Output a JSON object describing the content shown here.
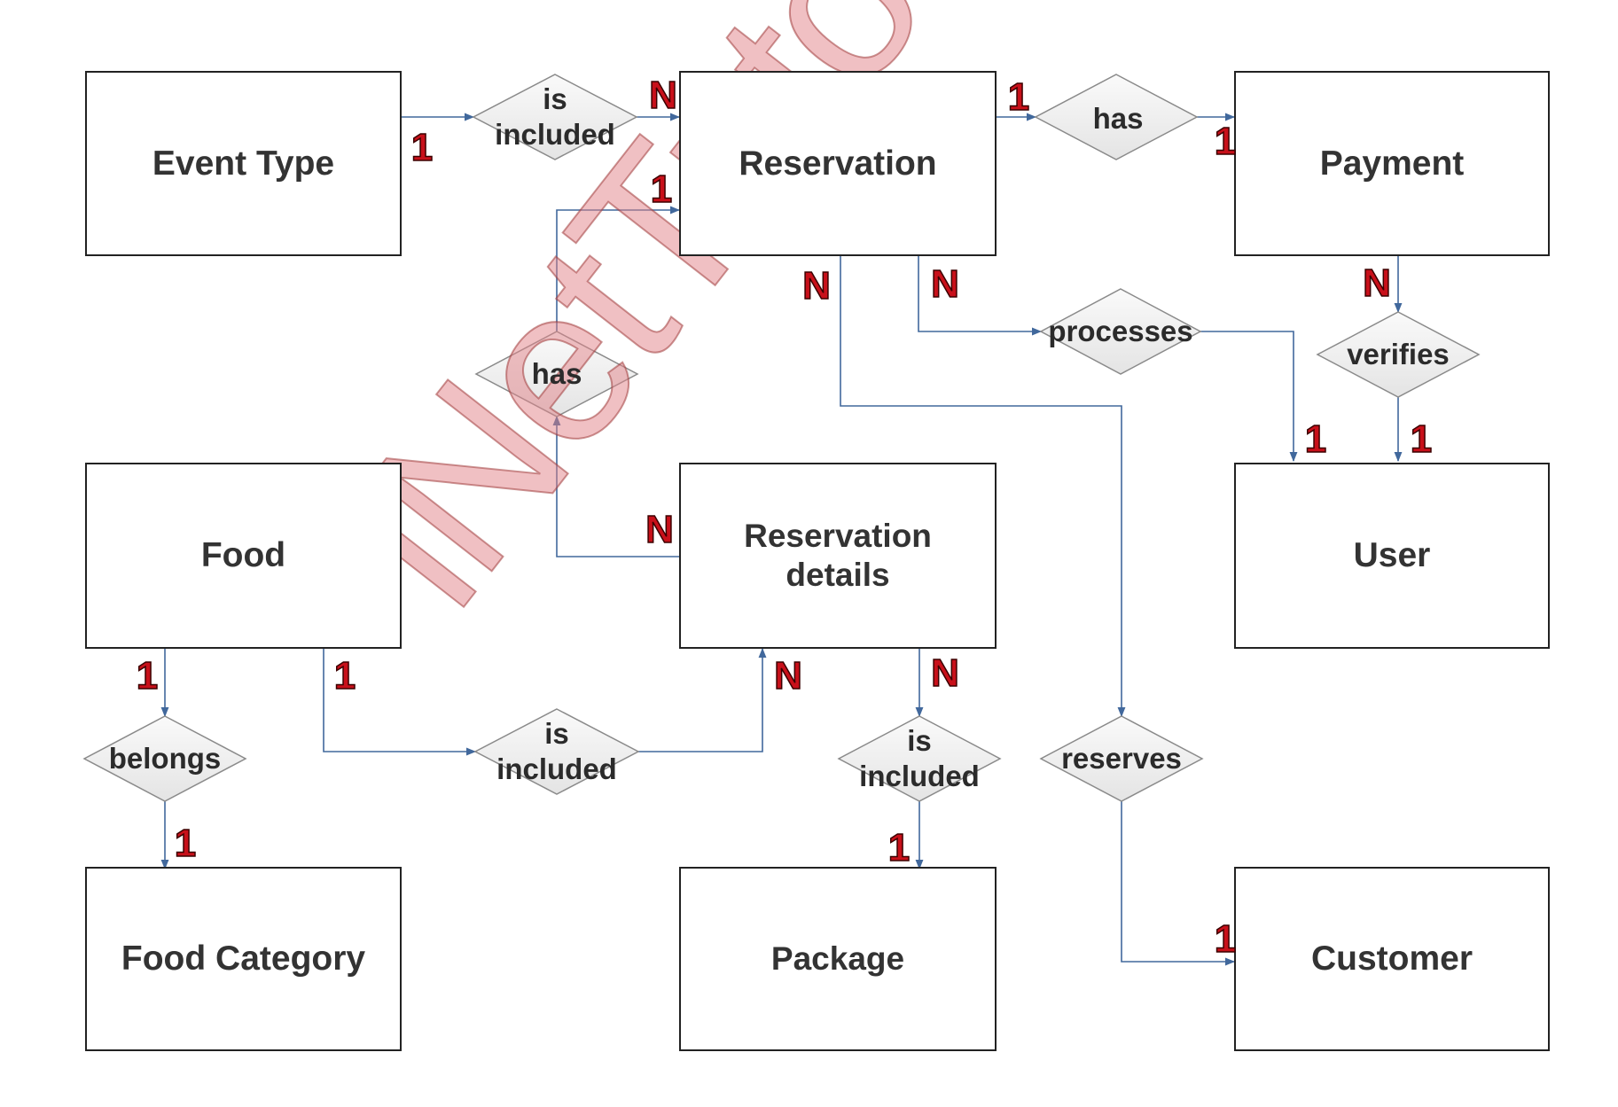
{
  "diagram": {
    "type": "Entity Relationship Diagram",
    "watermark": "iNetTutor.com",
    "colors": {
      "connector": "#41689c",
      "cardinality": "#c8101a",
      "entity_border": "#222222",
      "relationship_fill": "#eeeeee",
      "relationship_border": "#8a8a8a",
      "watermark": "#e28288"
    },
    "entities": [
      {
        "id": "event_type",
        "label": "Event Type"
      },
      {
        "id": "reservation",
        "label": "Reservation"
      },
      {
        "id": "payment",
        "label": "Payment"
      },
      {
        "id": "food",
        "label": "Food"
      },
      {
        "id": "reservation_details",
        "label": "Reservation\ndetails"
      },
      {
        "id": "user",
        "label": "User"
      },
      {
        "id": "food_category",
        "label": "Food Category"
      },
      {
        "id": "package",
        "label": "Package"
      },
      {
        "id": "customer",
        "label": "Customer"
      }
    ],
    "relationships": [
      {
        "id": "event_type_reservation",
        "label": "is\nincluded",
        "from": "Event Type",
        "to": "Reservation",
        "from_card": "1",
        "to_card": "N"
      },
      {
        "id": "reservation_payment",
        "label": "has",
        "from": "Reservation",
        "to": "Payment",
        "from_card": "1",
        "to_card": "1"
      },
      {
        "id": "details_reservation",
        "label": "has",
        "from": "Reservation details",
        "to": "Reservation",
        "from_card": "N",
        "to_card": "1"
      },
      {
        "id": "reservation_user",
        "label": "processes",
        "from": "Reservation",
        "to": "User",
        "from_card": "N",
        "to_card": "1"
      },
      {
        "id": "payment_user",
        "label": "verifies",
        "from": "Payment",
        "to": "User",
        "from_card": "N",
        "to_card": "1"
      },
      {
        "id": "food_category",
        "label": "belongs",
        "from": "Food",
        "to": "Food Category",
        "from_card": "1",
        "to_card": "1"
      },
      {
        "id": "food_details",
        "label": "is\nincluded",
        "from": "Food",
        "to": "Reservation details",
        "from_card": "1",
        "to_card": "N"
      },
      {
        "id": "details_package",
        "label": "is\nincluded",
        "from": "Reservation details",
        "to": "Package",
        "from_card": "N",
        "to_card": "1"
      },
      {
        "id": "reservation_customer",
        "label": "reserves",
        "from": "Reservation",
        "to": "Customer",
        "from_card": "N",
        "to_card": "1"
      }
    ]
  }
}
